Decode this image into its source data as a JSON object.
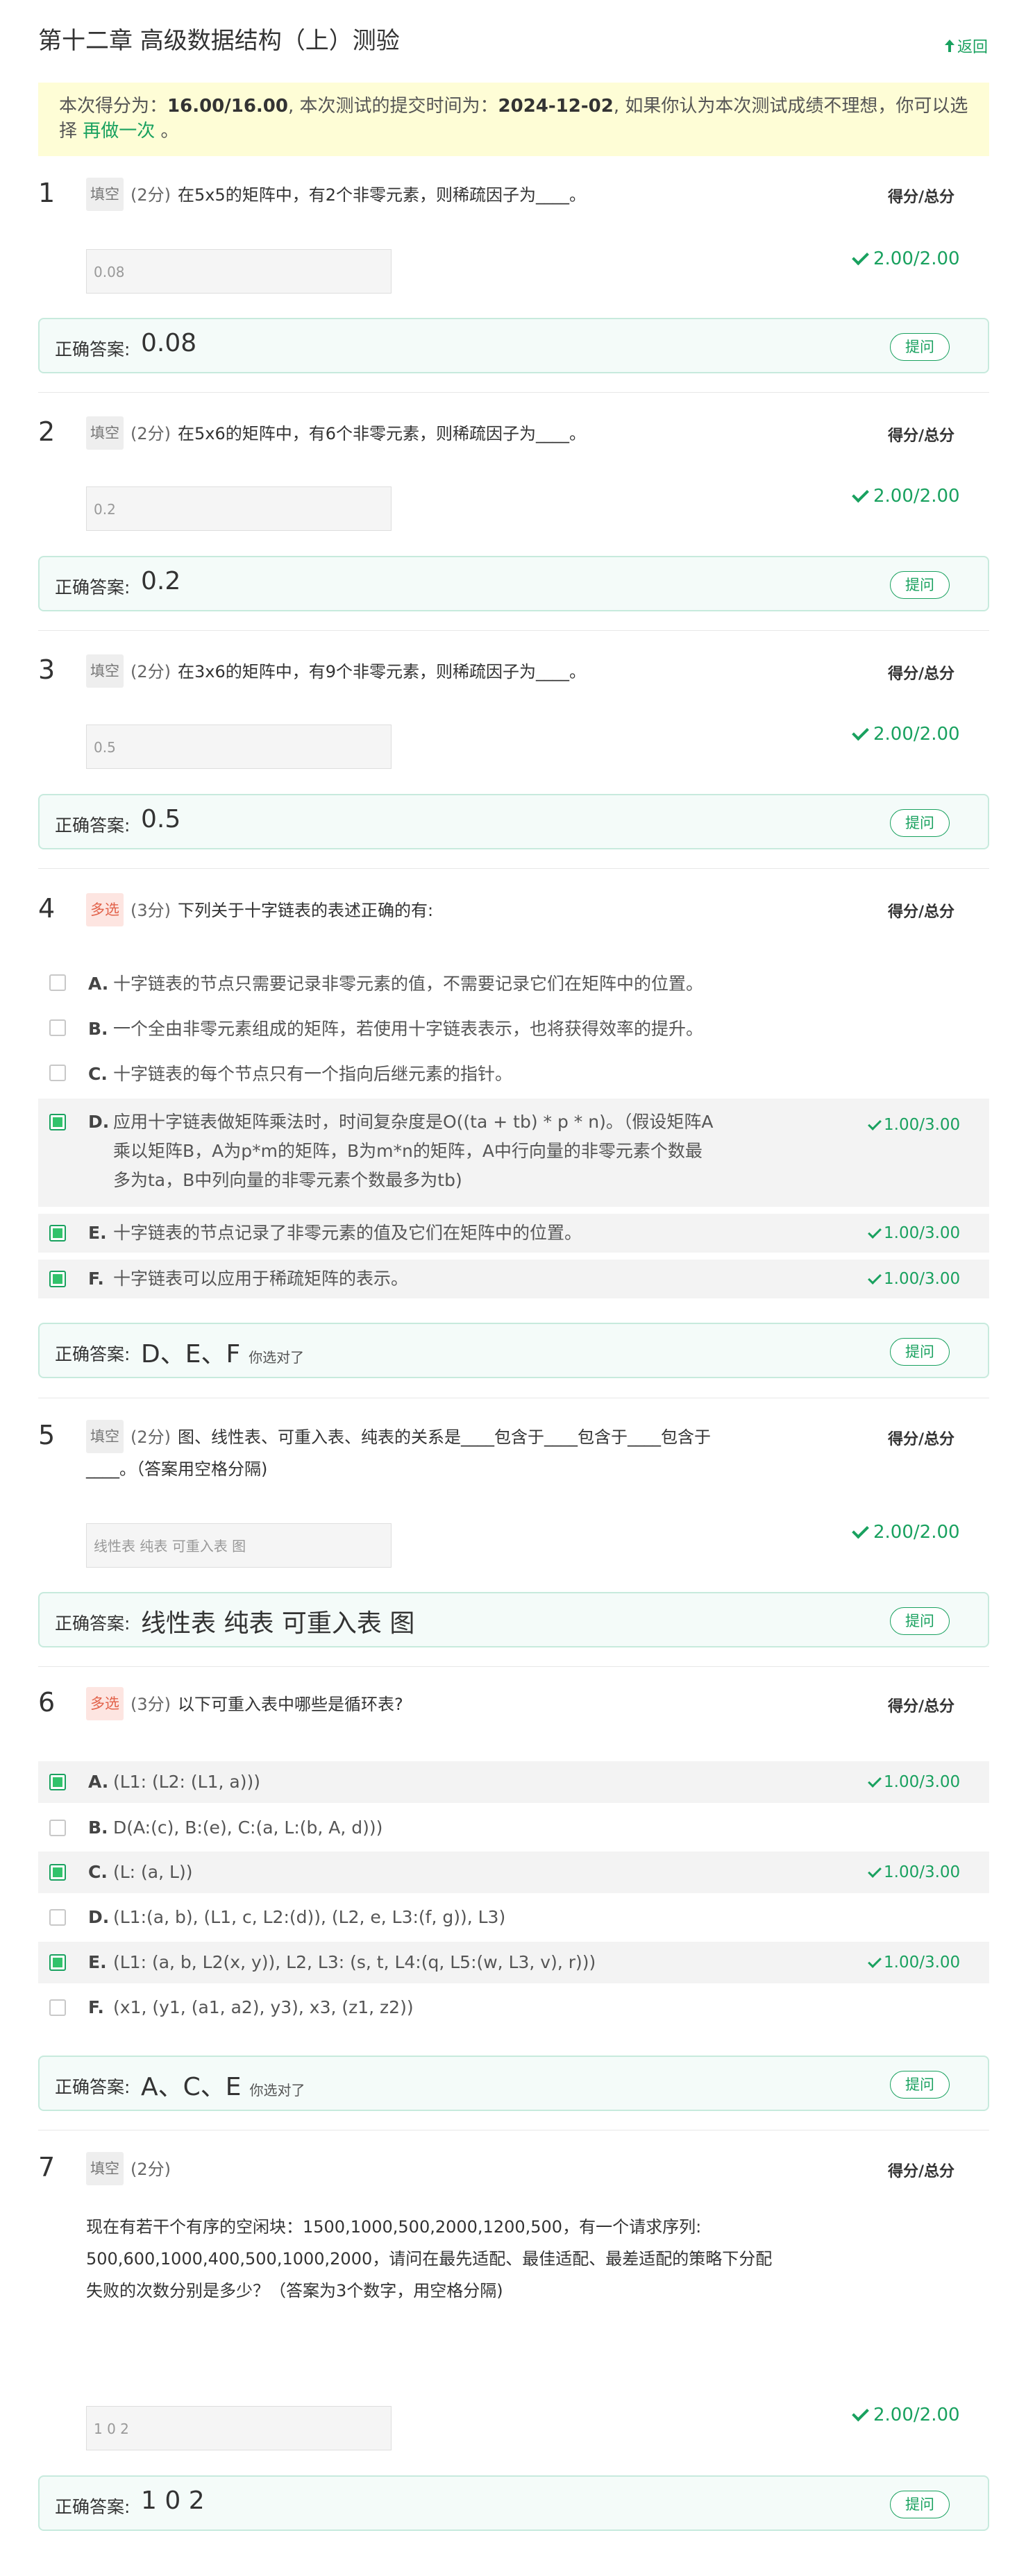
{
  "header": {
    "title": "第十二章 高级数据结构（上）测验",
    "back_label": "返回"
  },
  "score_bar": {
    "prefix": "本次得分为：",
    "score": "16.00/16.00",
    "mid": ", 本次测试的提交时间为：",
    "date": "2024-12-02",
    "suffix_line1": ", 如果你认为本次测试成绩不理想，你可以选",
    "suffix_line2_start": "择 ",
    "retry_label": "再做一次",
    "suffix_end": " 。"
  },
  "common": {
    "score_total_label": "得分/总分",
    "correct_label": "正确答案:",
    "ask_label": "提问",
    "you_chose_right": "你选对了"
  },
  "questions": [
    {
      "num": "1",
      "tag": "填空",
      "points": "(2分)",
      "stem": "在5x5的矩阵中，有2个非零元素，则稀疏因子为____。",
      "input_value": "0.08",
      "score": "2.00/2.00",
      "correct": "0.08"
    },
    {
      "num": "2",
      "tag": "填空",
      "points": "(2分)",
      "stem": "在5x6的矩阵中，有6个非零元素，则稀疏因子为____。",
      "input_value": "0.2",
      "score": "2.00/2.00",
      "correct": "0.2"
    },
    {
      "num": "3",
      "tag": "填空",
      "points": "(2分)",
      "stem": "在3x6的矩阵中，有9个非零元素，则稀疏因子为____。",
      "input_value": "0.5",
      "score": "2.00/2.00",
      "correct": "0.5"
    },
    {
      "num": "4",
      "tag": "多选",
      "points": "(3分)",
      "stem": "下列关于十字链表的表述正确的有:",
      "options": [
        {
          "letter": "A.",
          "text": "十字链表的节点只需要记录非零元素的值，不需要记录它们在矩阵中的位置。",
          "selected": false,
          "score": ""
        },
        {
          "letter": "B.",
          "text": "一个全由非零元素组成的矩阵，若使用十字链表表示，也将获得效率的提升。",
          "selected": false,
          "score": ""
        },
        {
          "letter": "C.",
          "text": "十字链表的每个节点只有一个指向后继元素的指针。",
          "selected": false,
          "score": ""
        },
        {
          "letter": "D.",
          "text_line1": "应用十字链表做矩阵乘法时，时间复杂度是O((ta + tb) * p * n)。（假设矩阵A",
          "text_line2": "乘以矩阵B，A为p*m的矩阵，B为m*n的矩阵，A中行向量的非零元素个数最",
          "text_line3": "多为ta，B中列向量的非零元素个数最多为tb)",
          "selected": true,
          "score": "1.00/3.00"
        },
        {
          "letter": "E.",
          "text": "十字链表的节点记录了非零元素的值及它们在矩阵中的位置。",
          "selected": true,
          "score": "1.00/3.00"
        },
        {
          "letter": "F.",
          "text": "十字链表可以应用于稀疏矩阵的表示。",
          "selected": true,
          "score": "1.00/3.00"
        }
      ],
      "correct": "D、E、F"
    },
    {
      "num": "5",
      "tag": "填空",
      "points": "(2分)",
      "stem_line1": "图、线性表、可重入表、纯表的关系是____包含于____包含于____包含于",
      "stem_line2": "____。（答案用空格分隔)",
      "input_value": "线性表 纯表 可重入表 图",
      "score": "2.00/2.00",
      "correct": "线性表 纯表 可重入表 图"
    },
    {
      "num": "6",
      "tag": "多选",
      "points": "(3分)",
      "stem": "以下可重入表中哪些是循环表?",
      "options": [
        {
          "letter": "A.",
          "text": "(L1: (L2: (L1, a)))",
          "selected": true,
          "score": "1.00/3.00"
        },
        {
          "letter": "B.",
          "text": "D(A:(c), B:(e), C:(a, L:(b, A, d)))",
          "selected": false,
          "score": ""
        },
        {
          "letter": "C.",
          "text": " (L: (a, L))",
          "selected": true,
          "score": "1.00/3.00"
        },
        {
          "letter": "D.",
          "text": "(L1:(a, b), (L1, c, L2:(d)), (L2, e, L3:(f, g)), L3)",
          "selected": false,
          "score": ""
        },
        {
          "letter": "E.",
          "text": "(L1: (a, b, L2(x, y)), L2, L3: (s, t, L4:(q, L5:(w, L3, v), r)))",
          "selected": true,
          "score": "1.00/3.00"
        },
        {
          "letter": "F.",
          "text": " (x1, (y1, (a1, a2), y3), x3, (z1, z2))",
          "selected": false,
          "score": ""
        }
      ],
      "correct": "A、C、E"
    },
    {
      "num": "7",
      "tag": "填空",
      "points": "(2分)",
      "stem_line1": "现在有若干个有序的空闲块：1500,1000,500,2000,1200,500，有一个请求序列:",
      "stem_line2": "500,600,1000,400,500,1000,2000，请问在最先适配、最佳适配、最差适配的策略下分配",
      "stem_line3": "失败的次数分别是多少？（答案为3个数字，用空格分隔)",
      "input_value": "1 0 2",
      "score": "2.00/2.00",
      "correct": "1 0 2"
    }
  ]
}
